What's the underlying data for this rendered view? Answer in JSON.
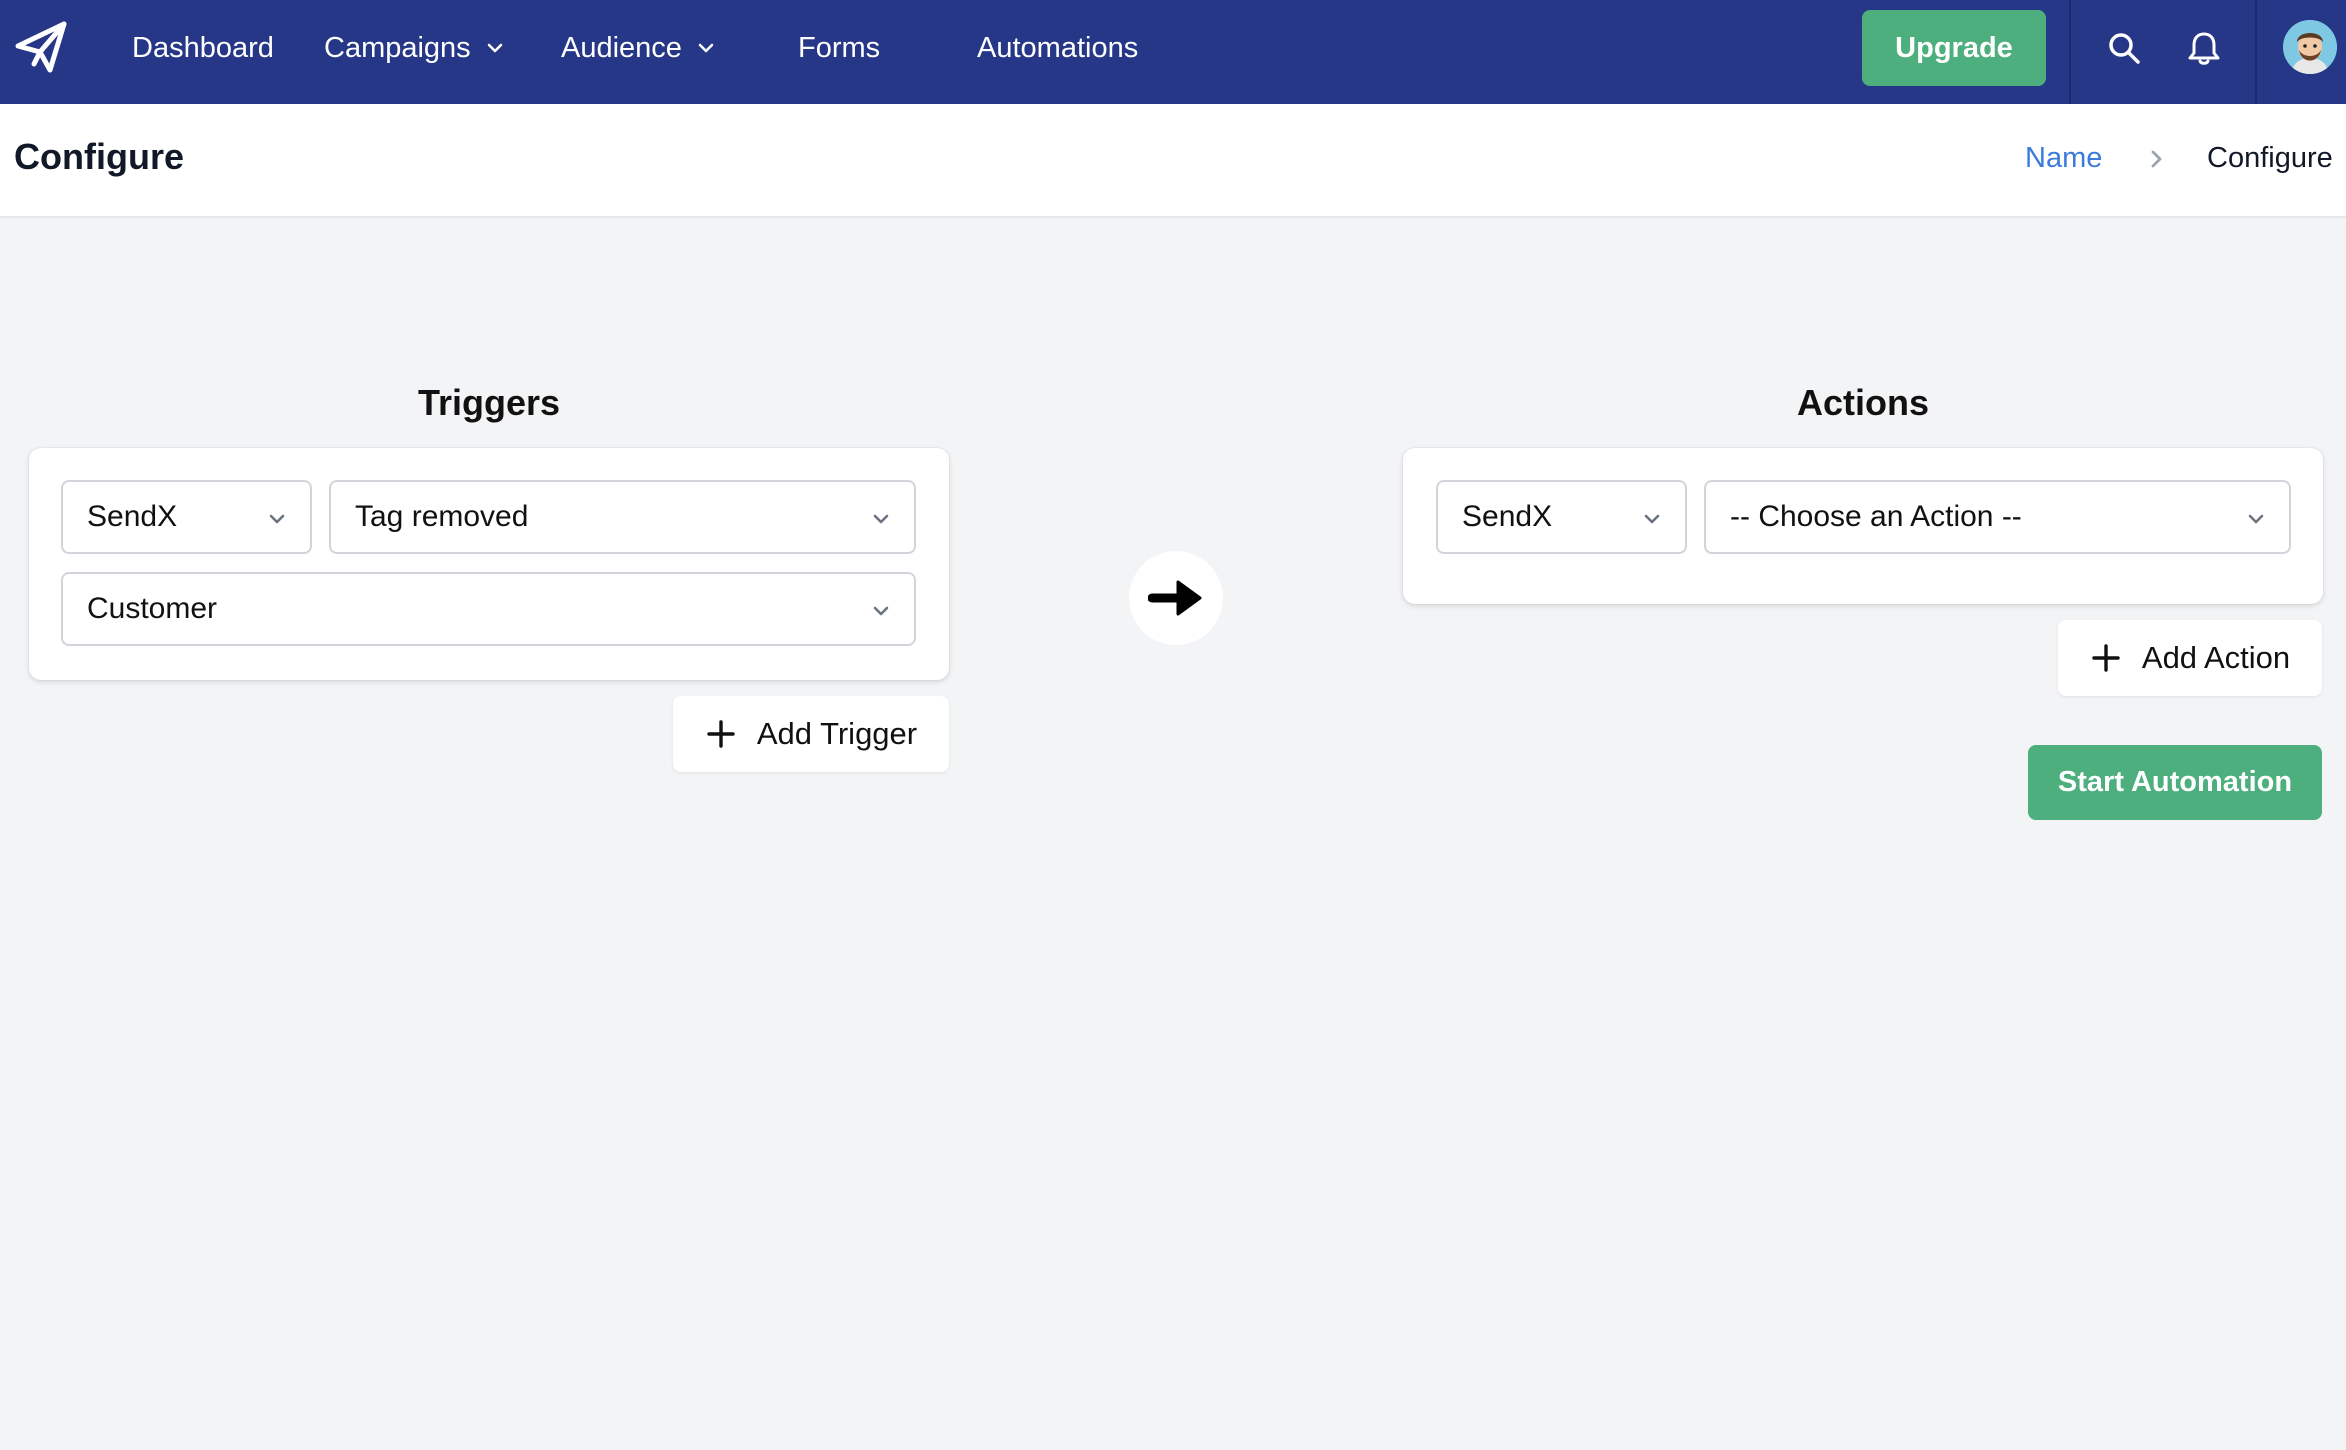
{
  "nav": {
    "items": [
      {
        "label": "Dashboard"
      },
      {
        "label": "Campaigns"
      },
      {
        "label": "Audience"
      },
      {
        "label": "Forms"
      },
      {
        "label": "Automations"
      }
    ],
    "upgrade_label": "Upgrade",
    "brand_color": "#253786",
    "accent_color": "#4caf7d"
  },
  "header": {
    "title": "Configure",
    "breadcrumb": {
      "link": "Name",
      "current": "Configure"
    }
  },
  "triggers": {
    "title": "Triggers",
    "app_select": "SendX",
    "event_select": "Tag removed",
    "tag_select": "Customer",
    "add_label": "Add Trigger"
  },
  "actions": {
    "title": "Actions",
    "app_select": "SendX",
    "action_select": "-- Choose an Action --",
    "add_label": "Add Action",
    "start_label": "Start Automation"
  }
}
